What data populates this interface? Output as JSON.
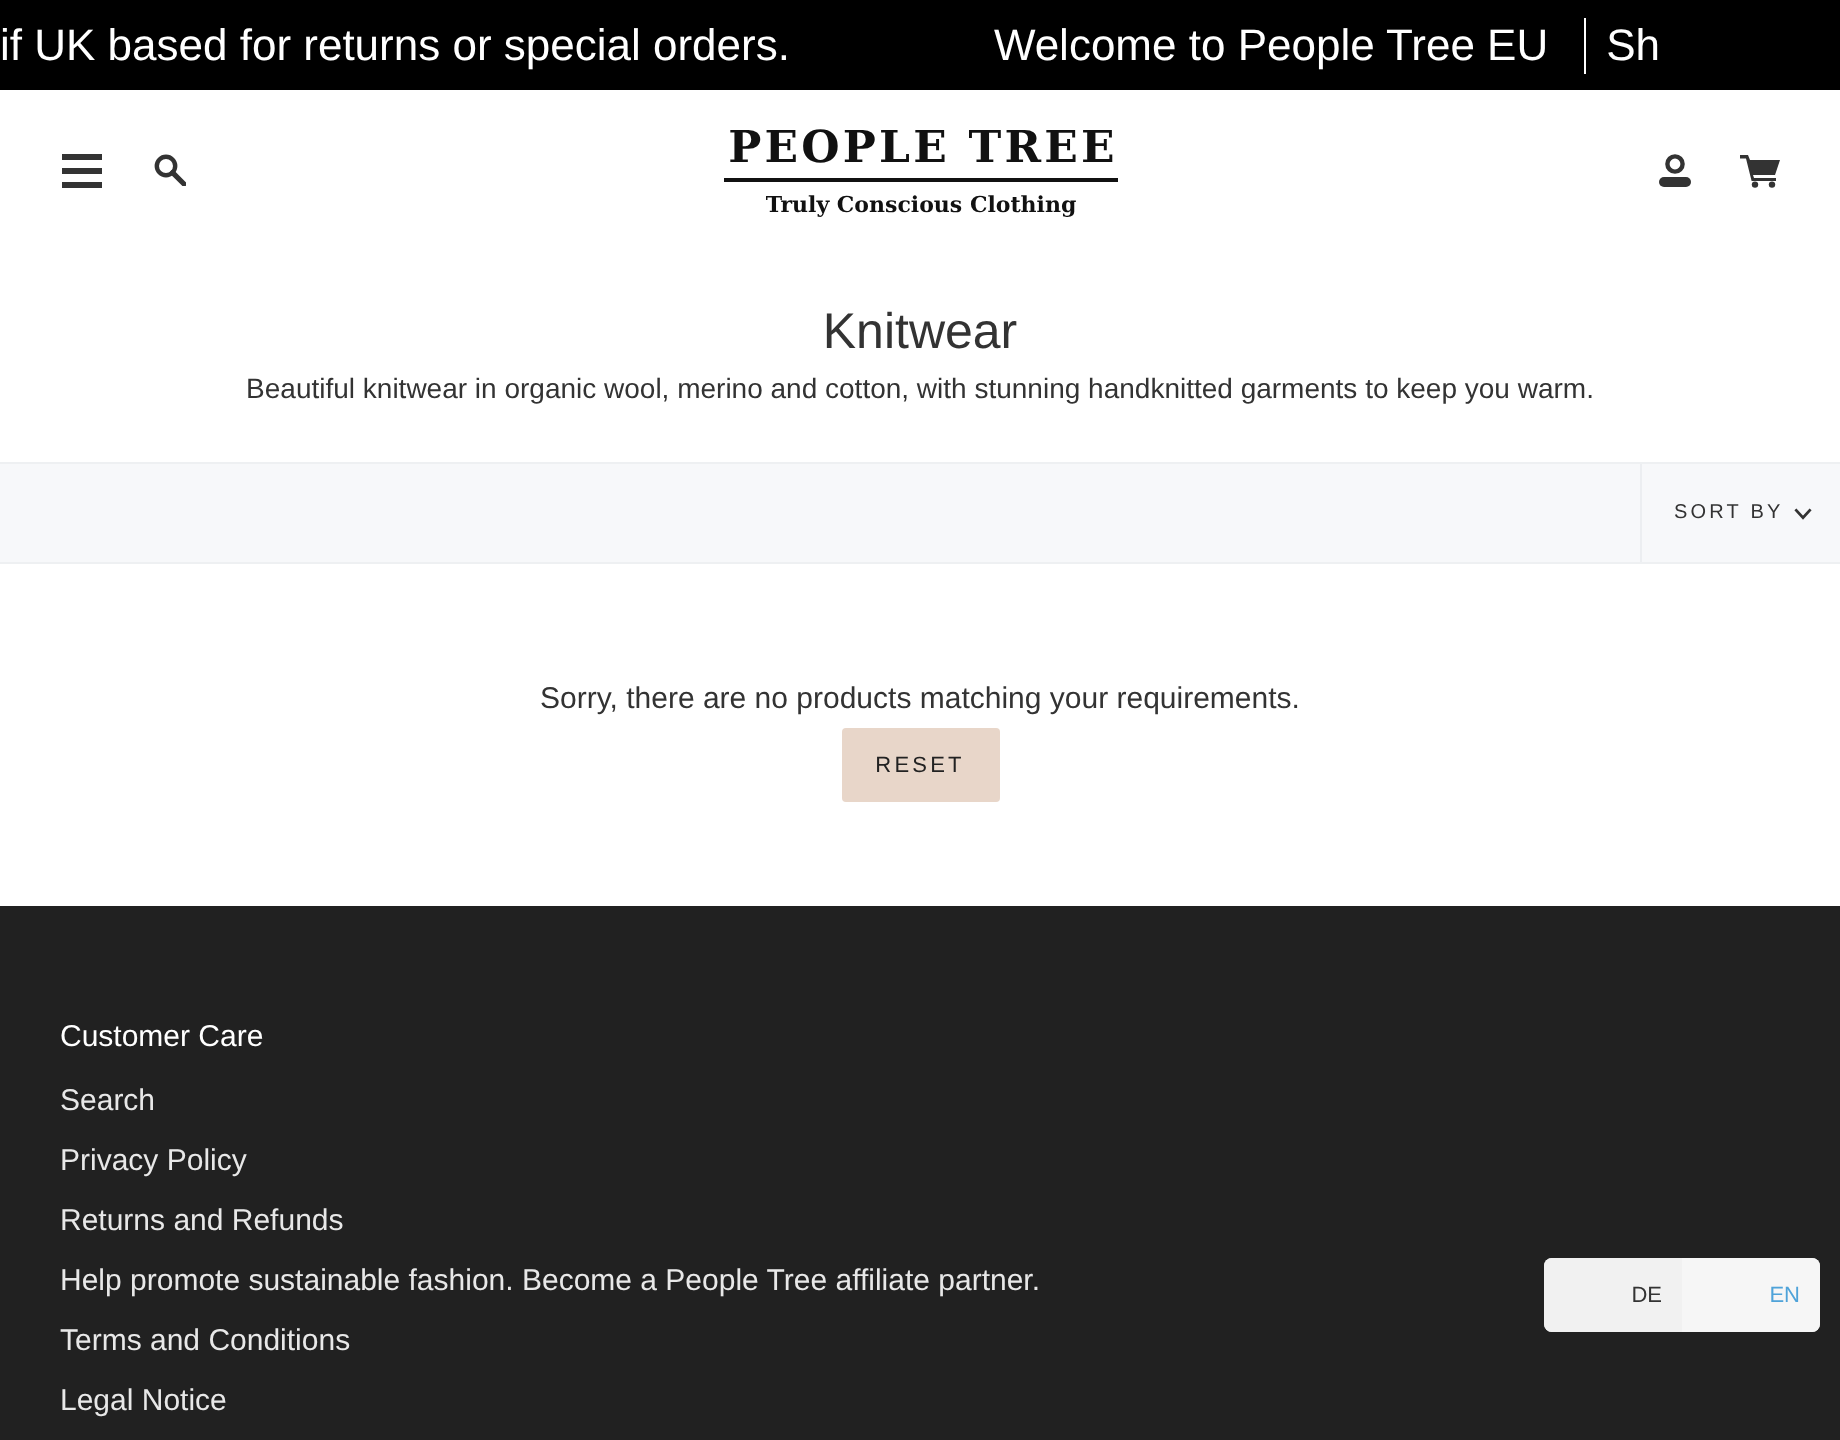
{
  "announcement_bar": {
    "messages": [
      {
        "text": "if UK based for returns or special orders.",
        "separated": false
      },
      {
        "text": "Welcome to People Tree EU",
        "separated": false
      },
      {
        "text": "Sh",
        "separated": true
      }
    ]
  },
  "header": {
    "logo": {
      "wordmark": "PEOPLE TREE",
      "tagline": "Truly Conscious Clothing"
    }
  },
  "collection": {
    "title": "Knitwear",
    "description": "Beautiful knitwear in organic wool, merino and cotton, with stunning handknitted garments to keep you warm."
  },
  "filter_bar": {
    "sort_label": "SORT BY"
  },
  "empty_state": {
    "message": "Sorry, there are no products matching your requirements.",
    "button": "RESET"
  },
  "footer": {
    "heading": "Customer Care",
    "links": [
      "Search",
      "Privacy Policy",
      "Returns and Refunds",
      "Help promote sustainable fashion. Become a People Tree affiliate partner.",
      "Terms and Conditions",
      "Legal Notice"
    ]
  },
  "language_switcher": {
    "options": [
      {
        "label": "DE",
        "selected": false
      },
      {
        "label": "EN",
        "selected": true
      }
    ]
  }
}
